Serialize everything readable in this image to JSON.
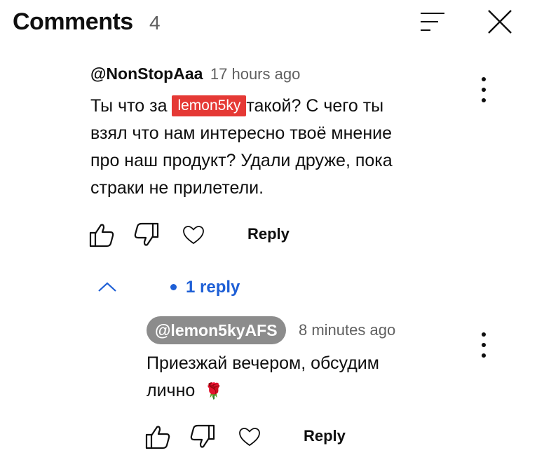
{
  "header": {
    "title": "Comments",
    "count": "4",
    "sort_icon": "sort-icon",
    "close_icon": "close-icon"
  },
  "comment": {
    "author": "@NonStopAaa",
    "time": "17 hours ago",
    "text_before_mention": "Ты что за",
    "mention": "lemon5ky",
    "text_after_mention": "такой? С чего ты",
    "text_line2": "взял что нам интересно твоё мнение",
    "text_line3": "про наш продукт? Удали друже, пока",
    "text_line4": "страки не прилетели.",
    "reply_label": "Reply"
  },
  "replies_toggle": {
    "label": "1 reply"
  },
  "reply": {
    "author": "@lemon5kyAFS",
    "time": "8 minutes ago",
    "text_line1": "Приезжай вечером, обсудим",
    "text_line2": "лично",
    "emoji": "🌹",
    "reply_label": "Reply"
  }
}
